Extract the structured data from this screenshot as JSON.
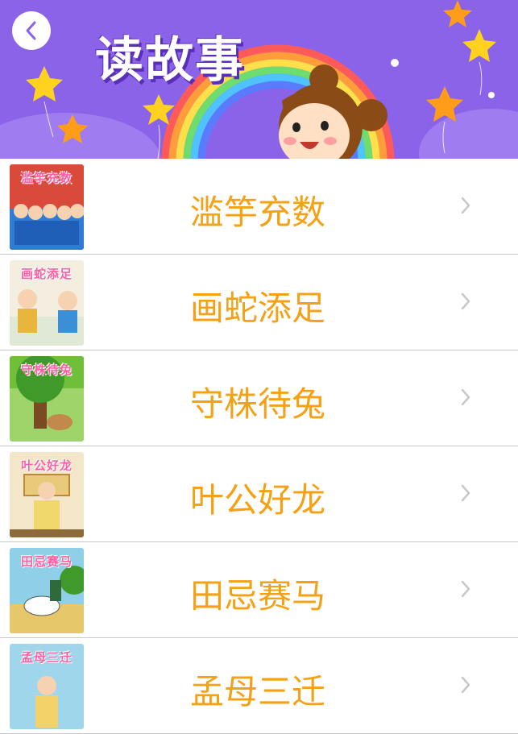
{
  "header": {
    "title": "读故事",
    "background_color": "#8a63e8",
    "back_icon": "chevron-left-icon"
  },
  "stories": [
    {
      "thumb_text": "滥竽充数",
      "label": "滥竽充数",
      "scene": "musicians"
    },
    {
      "thumb_text": "画蛇添足",
      "label": "画蛇添足",
      "scene": "painting"
    },
    {
      "thumb_text": "守株待兔",
      "label": "守株待兔",
      "scene": "tree"
    },
    {
      "thumb_text": "叶公好龙",
      "label": "叶公好龙",
      "scene": "palace"
    },
    {
      "thumb_text": "田忌赛马",
      "label": "田忌赛马",
      "scene": "horse"
    },
    {
      "thumb_text": "孟母三迁",
      "label": "孟母三迁",
      "scene": "mother"
    }
  ],
  "colors": {
    "label": "#f5a116",
    "divider": "#c9c9c9",
    "chevron": "#c7c7cc"
  }
}
